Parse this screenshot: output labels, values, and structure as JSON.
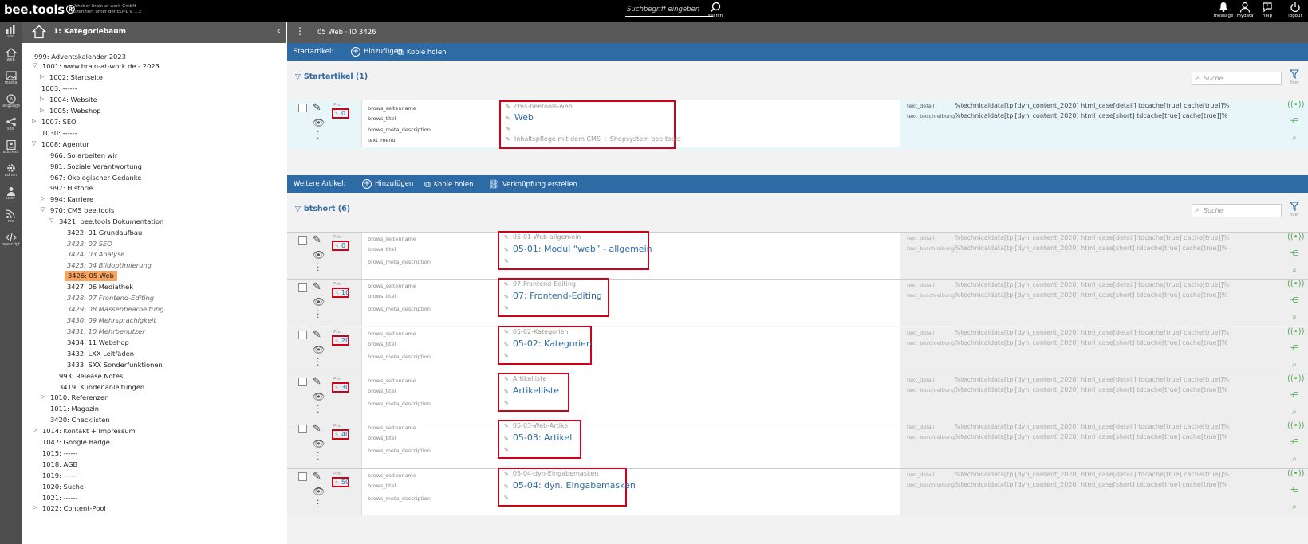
{
  "topbar": {
    "logo": "bee.tools®",
    "logo_sub": "Urheber brain at work GmbH Lizenziert unter der EUPL v. 1.2",
    "search_placeholder": "Suchbegriff eingeben",
    "search_label": "search",
    "icons": [
      {
        "name": "message",
        "label": "message"
      },
      {
        "name": "mydata",
        "label": "mydata"
      },
      {
        "name": "help",
        "label": "help"
      },
      {
        "name": "logout",
        "label": "logout"
      }
    ]
  },
  "rail": [
    {
      "label": "seo"
    },
    {
      "label": "web"
    },
    {
      "label": "media"
    },
    {
      "label": "language"
    },
    {
      "label": "site"
    },
    {
      "label": "address"
    },
    {
      "label": "admin"
    },
    {
      "label": "user"
    },
    {
      "label": "rss"
    },
    {
      "label": "beescript"
    }
  ],
  "tree": {
    "title": "1: Kategoriebaum",
    "nodes": [
      {
        "label": "999: Adventskalender 2023",
        "style": ""
      },
      {
        "label": "1001: www.brain-at-work.de - 2023",
        "style": ""
      },
      {
        "label": "1002: Startseite",
        "style": ""
      },
      {
        "label": "1003: ------",
        "style": ""
      },
      {
        "label": "1004: Website",
        "style": ""
      },
      {
        "label": "1005: Webshop",
        "style": ""
      },
      {
        "label": "1007: SEO",
        "style": ""
      },
      {
        "label": "1030: ------",
        "style": ""
      },
      {
        "label": "1008: Agentur",
        "style": ""
      },
      {
        "label": "966: So arbeiten wir",
        "style": ""
      },
      {
        "label": "981: Soziale Verantwortung",
        "style": ""
      },
      {
        "label": "967: Ökologischer Gedanke",
        "style": ""
      },
      {
        "label": "997: Historie",
        "style": ""
      },
      {
        "label": "994: Karriere",
        "style": ""
      },
      {
        "label": "970: CMS bee.tools",
        "style": ""
      },
      {
        "label": "3421: bee.tools Dokumentation",
        "style": ""
      },
      {
        "label": "3422: 01 Grundaufbau",
        "style": ""
      },
      {
        "label": "3423: 02 SEO",
        "style": "italic"
      },
      {
        "label": "3424: 03 Analyse",
        "style": "italic"
      },
      {
        "label": "3425: 04 Bildoptimierung",
        "style": "italic"
      },
      {
        "label": "3426: 05 Web",
        "style": "active"
      },
      {
        "label": "3427: 06 Mediathek",
        "style": ""
      },
      {
        "label": "3428: 07 Frontend-Editing",
        "style": "italic"
      },
      {
        "label": "3429: 08 Massenbearbeitung",
        "style": "italic"
      },
      {
        "label": "3430: 09 Mehrsprachigkeit",
        "style": "italic"
      },
      {
        "label": "3431: 10 Mehrbenutzer",
        "style": "italic"
      },
      {
        "label": "3434: 11 Webshop",
        "style": ""
      },
      {
        "label": "3432: LXX Leitfäden",
        "style": ""
      },
      {
        "label": "3433: SXX Sonderfunktionen",
        "style": ""
      },
      {
        "label": "993: Release Notes",
        "style": ""
      },
      {
        "label": "3419: Kundenanleitungen",
        "style": ""
      },
      {
        "label": "1010: Referenzen",
        "style": ""
      },
      {
        "label": "1011: Magazin",
        "style": ""
      },
      {
        "label": "3420: Checklisten",
        "style": ""
      },
      {
        "label": "1014: Kontakt + Impressum",
        "style": ""
      },
      {
        "label": "1047: Google Badge",
        "style": ""
      },
      {
        "label": "1015: ------",
        "style": ""
      },
      {
        "label": "1018: AGB",
        "style": ""
      },
      {
        "label": "1019: ------",
        "style": ""
      },
      {
        "label": "1020: Suche",
        "style": ""
      },
      {
        "label": "1021: ------",
        "style": ""
      },
      {
        "label": "1022: Content-Pool",
        "style": ""
      }
    ]
  },
  "main": {
    "header": "05 Web · ID 3426",
    "startbar": {
      "label": "Startartikel:",
      "add": "Hinzufügen",
      "copy": "Kopie holen"
    },
    "start_section": {
      "title": "Startartikel (1)",
      "search": "Suche",
      "filter": "filter"
    },
    "start_article": {
      "prio_label": "Prio",
      "prio": "0",
      "labels": [
        "brows_seitenname",
        "brows_titel",
        "brows_meta_description",
        "text_menu"
      ],
      "values": [
        "cms-beetools-web",
        "Web",
        "",
        "Inhaltspflege mit dem CMS + Shopsystem bee.tools"
      ],
      "tech_labels": [
        "text_detail",
        "text_beschreibung"
      ],
      "tech_values": [
        "%technicaldata[tpl[dyn_content_2020] html_case[detail] tdcache[true] cache[true]]%",
        "%technicaldata[tpl[dyn_content_2020] html_case[short] tdcache[true] cache[true]]%"
      ]
    },
    "furtherbar": {
      "label": "Weitere Artikel:",
      "add": "Hinzufügen",
      "copy": "Kopie holen",
      "link": "Verknüpfung erstellen"
    },
    "bt_section": {
      "title": "btshort (6)",
      "search": "Suche",
      "filter": "filter"
    },
    "field_labels": [
      "brows_seitenname",
      "brows_titel",
      "brows_meta_description"
    ],
    "tech_labels": [
      "text_detail",
      "text_beschreibung"
    ],
    "tech_values": [
      "%technicaldata[tpl[dyn_content_2020] html_case[detail] tdcache[true] cache[true]]%",
      "%technicaldata[tpl[dyn_content_2020] html_case[short] tdcache[true] cache[true]]%"
    ],
    "articles": [
      {
        "prio_label": "Prio",
        "prio": "0",
        "seitenname": "05-01-Web-allgemein",
        "titel": "05-01: Modul “web” - allgemein"
      },
      {
        "prio_label": "Prio",
        "prio": "10",
        "seitenname": "07-Frontend-Editing",
        "titel": "07: Frontend-Editing"
      },
      {
        "prio_label": "Prio",
        "prio": "20",
        "seitenname": "05-02-Kategorien",
        "titel": "05-02: Kategorien"
      },
      {
        "prio_label": "Prio",
        "prio": "30",
        "seitenname": "Artikelliste",
        "titel": "Artikelliste"
      },
      {
        "prio_label": "Prio",
        "prio": "40",
        "seitenname": "05-03-Web-Artikel",
        "titel": "05-03: Artikel"
      },
      {
        "prio_label": "Prio",
        "prio": "50",
        "seitenname": "05-04-dyn-Eingabemasken",
        "titel": "05-04: dyn. Eingabemasken"
      }
    ]
  }
}
